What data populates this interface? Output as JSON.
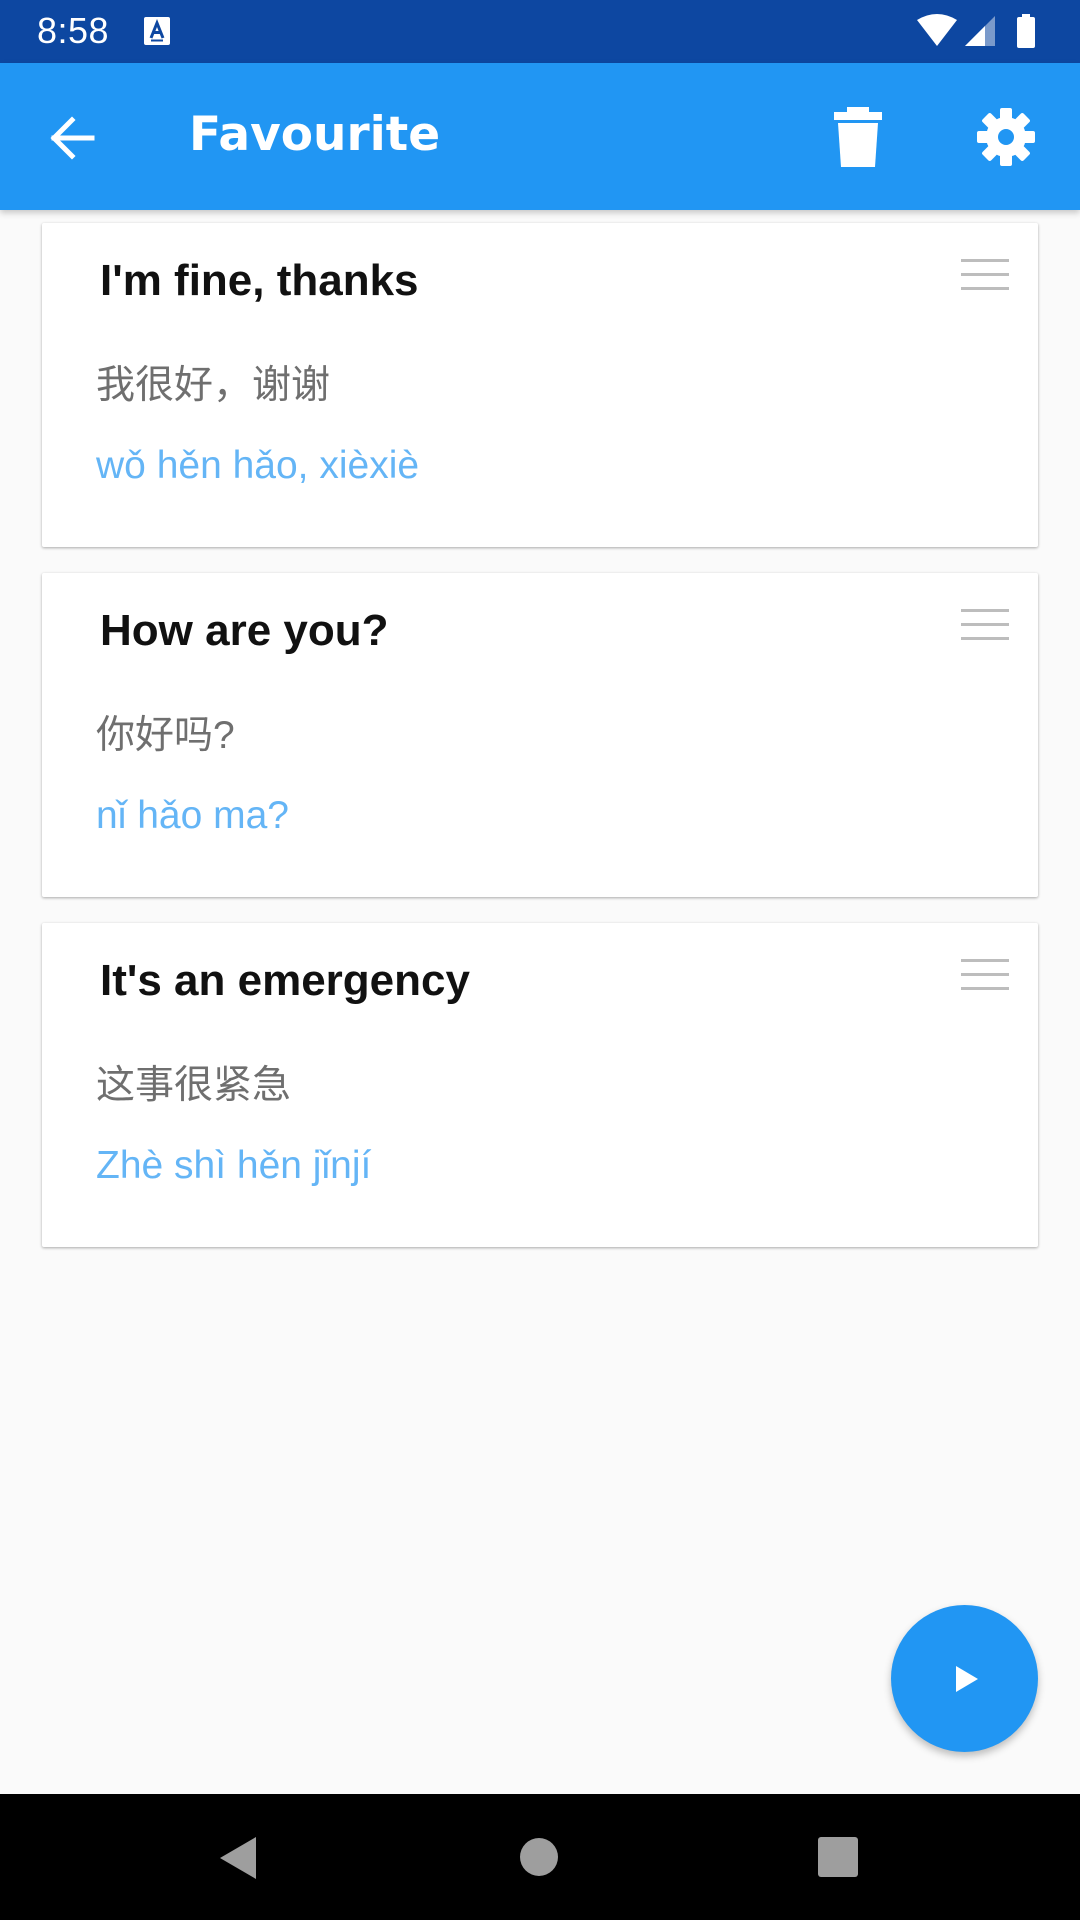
{
  "status_bar": {
    "time": "8:58",
    "icons": [
      "a-notification-icon",
      "wifi-icon",
      "signal-icon",
      "battery-icon"
    ]
  },
  "app_bar": {
    "title": "Favourite",
    "icons": [
      "back-arrow-icon",
      "delete-icon",
      "settings-gear-icon"
    ]
  },
  "cards": [
    {
      "english": "I'm fine, thanks",
      "chinese": "我很好，谢谢",
      "pinyin": "wǒ hěn hǎo, xièxiè"
    },
    {
      "english": "How are you?",
      "chinese": "你好吗?",
      "pinyin": "nǐ hǎo ma?"
    },
    {
      "english": "It's an emergency",
      "chinese": "这事很紧急",
      "pinyin": "Zhè shì hěn jǐnjí"
    }
  ],
  "fab": {
    "icon": "play-icon"
  },
  "nav_bar": {
    "icons": [
      "nav-back-icon",
      "nav-home-icon",
      "nav-recents-icon"
    ]
  },
  "colors": {
    "status_bar": "#0d47a1",
    "app_bar": "#2196f3",
    "pinyin": "#64b5f6",
    "chinese": "#6f6f6f",
    "background": "#fafafa"
  }
}
